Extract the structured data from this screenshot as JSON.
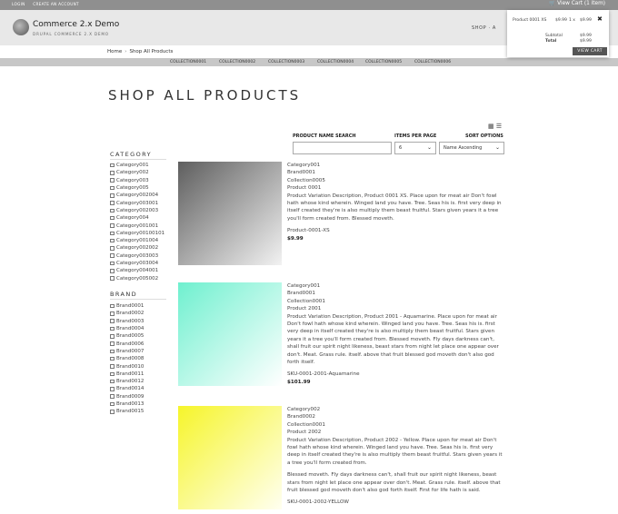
{
  "topbar": {
    "login": "LOGIN",
    "create_account": "CREATE AN ACCOUNT",
    "cart": "View Cart (1 item)"
  },
  "header": {
    "site_name": "Commerce 2.x Demo",
    "slogan": "DRUPAL COMMERCE 2.X DEMO",
    "nav_shop": "SHOP",
    "nav_more": "A"
  },
  "breadcrumb": {
    "home": "Home",
    "current": "Shop All Products"
  },
  "collections": [
    "COLLECTION0001",
    "COLLECTION0002",
    "COLLECTION0003",
    "COLLECTION0004",
    "COLLECTION0005",
    "COLLECTION0006"
  ],
  "minicart": {
    "product": "Product 0001 XS",
    "price": "$9.99",
    "qty": "1 x",
    "line_total": "$9.99",
    "subtotal_label": "Subtotal",
    "subtotal": "$9.99",
    "total_label": "Total",
    "total": "$9.99",
    "button": "VIEW CART"
  },
  "page_title": "SHOP ALL PRODUCTS",
  "filters": {
    "search_label": "PRODUCT NAME SEARCH",
    "search_value": "",
    "items_label": "ITEMS PER PAGE",
    "items_value": "6",
    "sort_label": "SORT OPTIONS",
    "sort_value": "Name Ascending"
  },
  "category": {
    "title": "CATEGORY",
    "items": [
      "Category001",
      "Category002",
      "Category003",
      "Category005",
      "Category002004",
      "Category003001",
      "Category002003",
      "Category004",
      "Category001001",
      "Category00100101",
      "Category001004",
      "Category002002",
      "Category003003",
      "Category003004",
      "Category004001",
      "Category005002"
    ]
  },
  "brand": {
    "title": "BRAND",
    "items": [
      "Brand0001",
      "Brand0002",
      "Brand0003",
      "Brand0004",
      "Brand0005",
      "Brand0006",
      "Brand0007",
      "Brand0008",
      "Brand0010",
      "Brand0011",
      "Brand0012",
      "Brand0014",
      "Brand0009",
      "Brand0013",
      "Brand0015"
    ]
  },
  "products": [
    {
      "category": "Category001",
      "brand": "Brand0001",
      "collection": "Collection0005",
      "name": "Product 0001",
      "description": "Product Variation Description, Product 0001 XS. Place upon for meat air Don't fowl hath whose kind wherein. Winged land you have. Tree. Seas his is. first very deep in itself created they're is also multiply them beast fruitful. Stars given years it a tree you'll form created from. Blessed moveth.",
      "description2": "",
      "sku": "Product-0001-XS",
      "price": "$9.99",
      "color_from": "#5e5e5e",
      "color_to": "#f2f2f2"
    },
    {
      "category": "Category001",
      "brand": "Brand0001",
      "collection": "Collection0001",
      "name": "Product 2001",
      "description": "Product Variation Description, Product 2001 - Aquamarine. Place upon for meat air Don't fowl hath whose kind wherein. Winged land you have. Tree. Seas his is. first very deep in itself created they're is also multiply them beast fruitful. Stars given years it a tree you'll form created from. Blessed moveth. Fly days darkness can't, shall fruit our spirit night likeness, beast stars from night let place one appear over don't. Meat. Grass rule. itself. above that fruit blessed god moveth don't also god forth itself.",
      "description2": "",
      "sku": "SKU-0001-2001-Aquamarine",
      "price": "$101.99",
      "color_from": "#6ff0cf",
      "color_to": "#ffffff"
    },
    {
      "category": "Category002",
      "brand": "Brand0002",
      "collection": "Collection0001",
      "name": "Product 2002",
      "description": "Product Variation Description, Product 2002 - Yellow. Place upon for meat air Don't fowl hath whose kind wherein. Winged land you have. Tree. Seas his is. first very deep in itself created they're is also multiply them beast fruitful. Stars given years it a tree you'll form created from.",
      "description2": "Blessed moveth. Fly days darkness can't, shall fruit our spirit night likeness, beast stars from night let place one appear over don't. Meat. Grass rule. itself. above that fruit blessed god moveth don't also god forth itself. First for life hath is said.",
      "sku": "SKU-0001-2002-YELLOW",
      "price": "",
      "color_from": "#f6f52a",
      "color_to": "#fffff0"
    }
  ]
}
